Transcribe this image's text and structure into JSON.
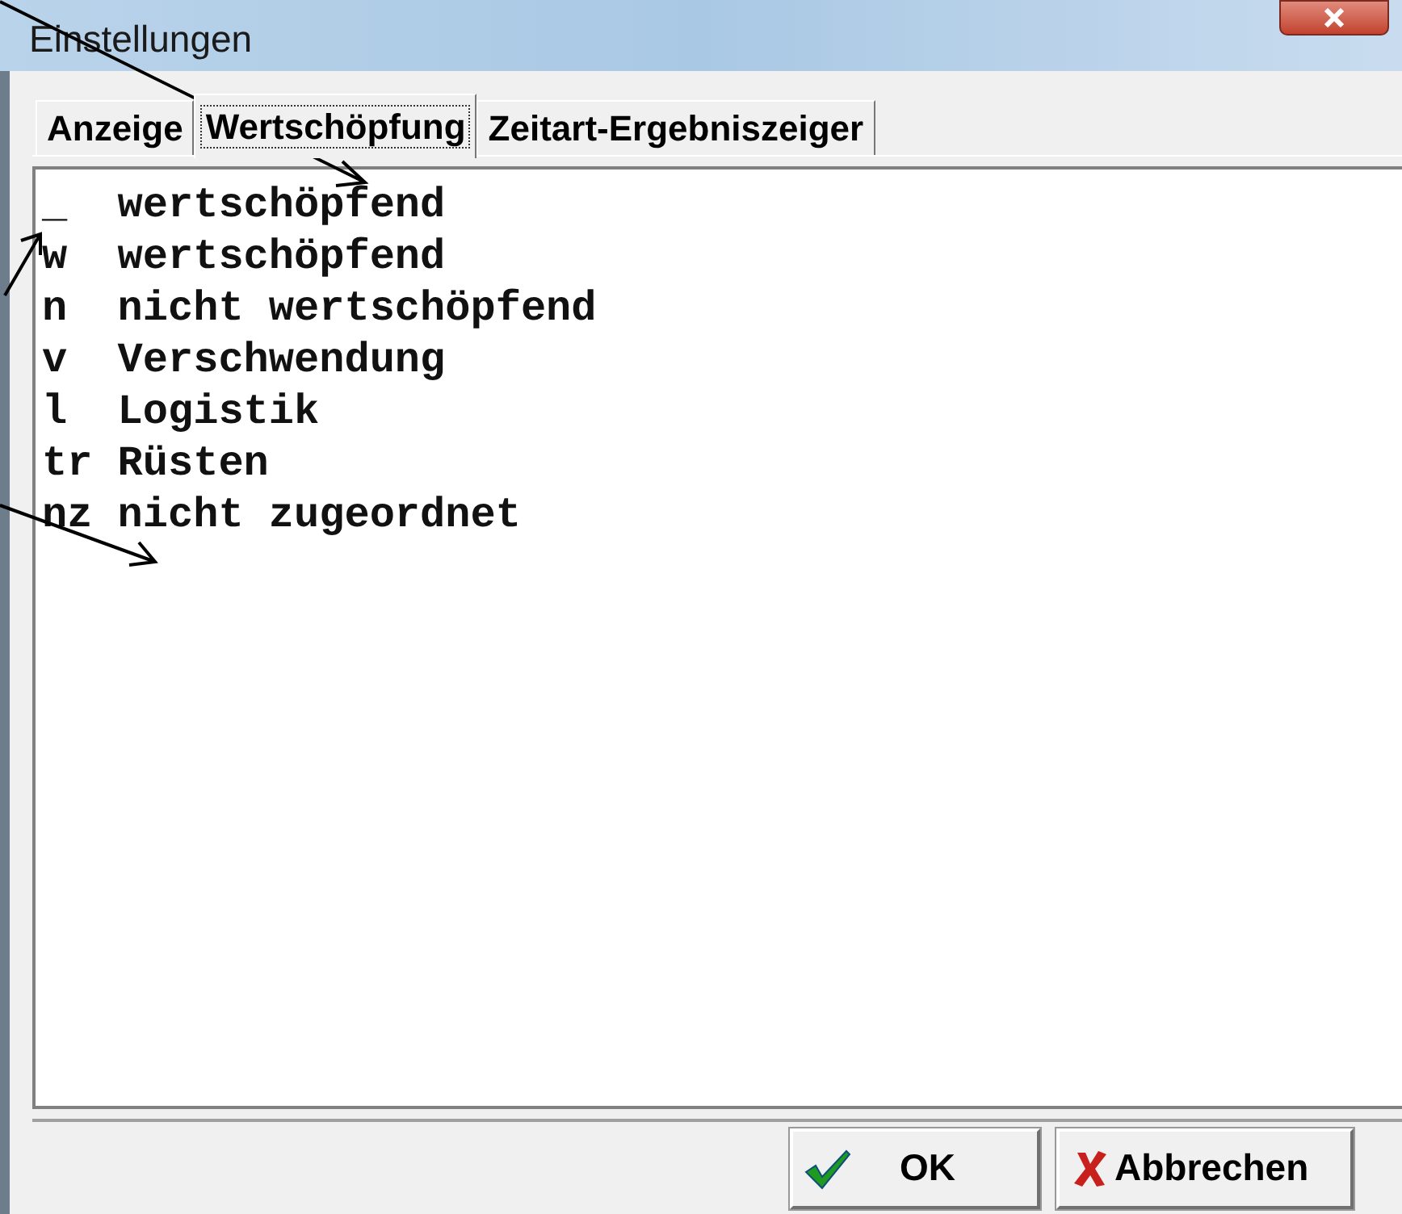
{
  "window": {
    "title": "Einstellungen"
  },
  "tabs": [
    {
      "label": "Anzeige",
      "selected": false
    },
    {
      "label": "Wertschöpfung",
      "selected": true
    },
    {
      "label": "Zeitart-Ergebniszeiger",
      "selected": false
    }
  ],
  "list": [
    {
      "code": "_",
      "label": "wertschöpfend"
    },
    {
      "code": "w",
      "label": "wertschöpfend"
    },
    {
      "code": "n",
      "label": "nicht wertschöpfend"
    },
    {
      "code": "v",
      "label": "Verschwendung"
    },
    {
      "code": "l",
      "label": "Logistik"
    },
    {
      "code": "tr",
      "label": "Rüsten"
    },
    {
      "code": "nz",
      "label": "nicht zugeordnet"
    }
  ],
  "buttons": [
    {
      "kind": "ok",
      "label": "OK"
    },
    {
      "kind": "cancel",
      "label": "Abbrechen"
    }
  ]
}
